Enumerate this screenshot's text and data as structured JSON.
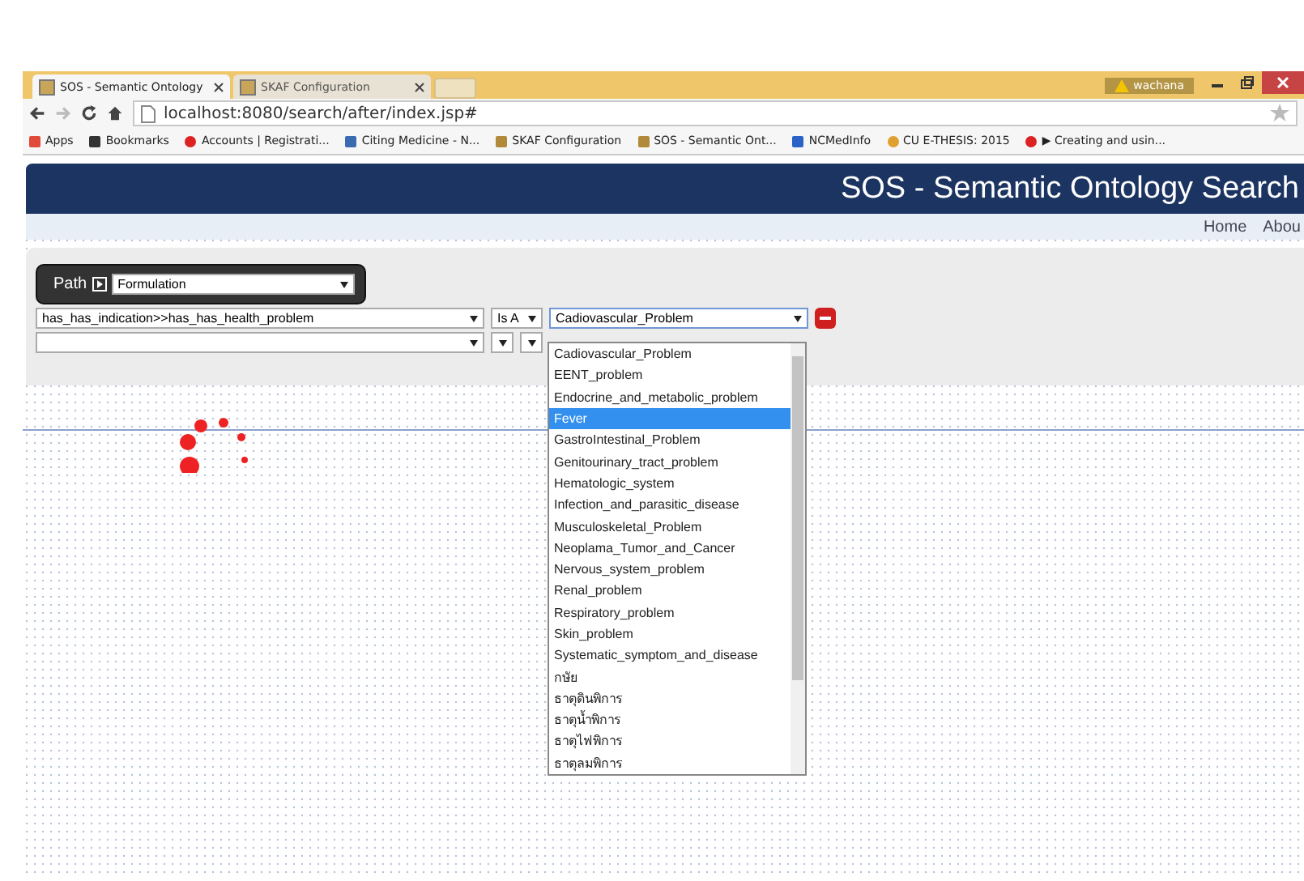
{
  "browser": {
    "tabs": [
      {
        "title": "SOS - Semantic Ontology",
        "selected": true
      },
      {
        "title": "SKAF Configuration",
        "selected": false
      }
    ],
    "user_badge": "wachana",
    "address": "localhost:8080/search/after/index.jsp#",
    "bookmarks": [
      {
        "label": "Apps",
        "kind": "apps"
      },
      {
        "label": "Bookmarks",
        "kind": "star"
      },
      {
        "label": "Accounts | Registrati...",
        "kind": "dot"
      },
      {
        "label": "Citing Medicine - N...",
        "kind": "swirl"
      },
      {
        "label": "SKAF Configuration",
        "kind": "page"
      },
      {
        "label": "SOS - Semantic Ont...",
        "kind": "page"
      },
      {
        "label": "NCMedInfo",
        "kind": "square"
      },
      {
        "label": "CU E-THESIS: 2015",
        "kind": "person"
      },
      {
        "label": "▶ Creating and usin...",
        "kind": "dot"
      }
    ]
  },
  "page": {
    "title": "SOS - Semantic Ontology Search",
    "nav": [
      "Home",
      "Abou"
    ],
    "path": {
      "label": "Path",
      "value": "Formulation"
    },
    "query_rows": [
      {
        "property": "has_has_indication>>has_has_health_problem",
        "relation": "Is A",
        "value": "Cadiovascular_Problem",
        "removable": true
      },
      {
        "property": "",
        "relation": "",
        "value": "",
        "removable": false
      }
    ],
    "dropdown": [
      {
        "label": "Cadiovascular_Problem",
        "selected": false
      },
      {
        "label": "EENT_problem",
        "selected": false
      },
      {
        "label": "Endocrine_and_metabolic_problem",
        "selected": false
      },
      {
        "label": "Fever",
        "selected": true
      },
      {
        "label": "GastroIntestinal_Problem",
        "selected": false
      },
      {
        "label": "Genitourinary_tract_problem",
        "selected": false
      },
      {
        "label": "Hematologic_system",
        "selected": false
      },
      {
        "label": "Infection_and_parasitic_disease",
        "selected": false
      },
      {
        "label": "Musculoskeletal_Problem",
        "selected": false
      },
      {
        "label": "Neoplama_Tumor_and_Cancer",
        "selected": false
      },
      {
        "label": "Nervous_system_problem",
        "selected": false
      },
      {
        "label": "Renal_problem",
        "selected": false
      },
      {
        "label": "Respiratory_problem",
        "selected": false
      },
      {
        "label": "Skin_problem",
        "selected": false
      },
      {
        "label": "Systematic_symptom_and_disease",
        "selected": false
      },
      {
        "label": "กษัย",
        "selected": false
      },
      {
        "label": "ธาตุดินพิการ",
        "selected": false
      },
      {
        "label": "ธาตุน้ำพิการ",
        "selected": false
      },
      {
        "label": "ธาตุไฟพิการ",
        "selected": false
      },
      {
        "label": "ธาตุลมพิการ",
        "selected": false
      }
    ]
  }
}
